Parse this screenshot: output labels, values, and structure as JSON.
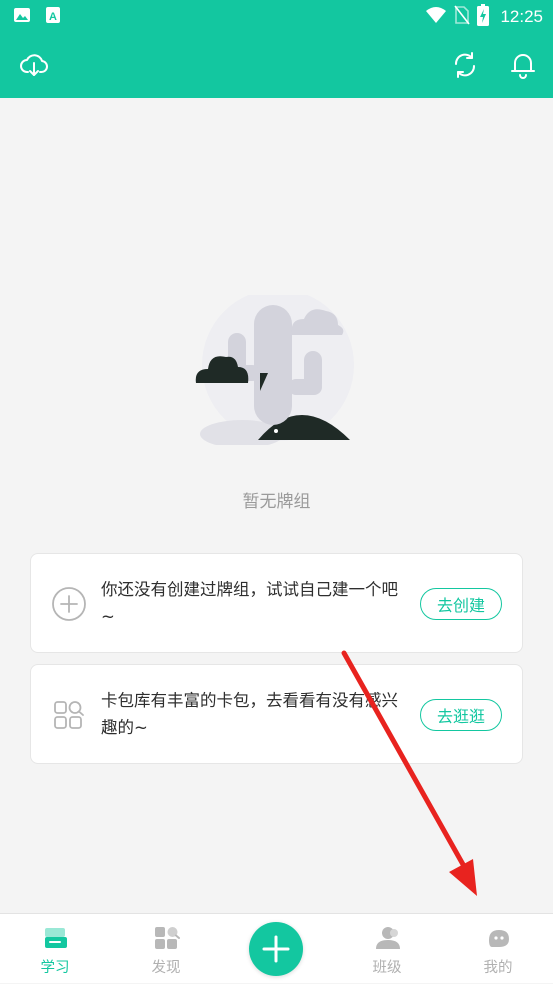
{
  "status_bar": {
    "time": "12:25",
    "left_icons": [
      "image-icon",
      "app-a-icon"
    ],
    "right_icons": [
      "wifi-icon",
      "no-sim-icon",
      "battery-charging-icon"
    ]
  },
  "app_bar": {
    "left_icon": "cloud-download-icon",
    "right_icons": [
      "sync-icon",
      "bell-icon"
    ],
    "background_color": "#13c7a0"
  },
  "empty_state": {
    "illustration": "cactus-illustration",
    "text": "暂无牌组"
  },
  "cards": [
    {
      "icon": "plus-circle-icon",
      "text": "你还没有创建过牌组，试试自己建一个吧~",
      "button": "去创建"
    },
    {
      "icon": "apps-grid-icon",
      "text": "卡包库有丰富的卡包，去看看有没有感兴趣的~",
      "button": "去逛逛"
    }
  ],
  "bottom_nav": {
    "items": [
      {
        "label": "学习",
        "icon": "study-icon",
        "active": true
      },
      {
        "label": "发现",
        "icon": "discover-icon",
        "active": false
      },
      {
        "label": "班级",
        "icon": "class-icon",
        "active": false
      },
      {
        "label": "我的",
        "icon": "profile-icon",
        "active": false
      }
    ],
    "center_button": "add-icon"
  },
  "colors": {
    "accent": "#13c7a0",
    "annotation_arrow": "#e8231f"
  }
}
